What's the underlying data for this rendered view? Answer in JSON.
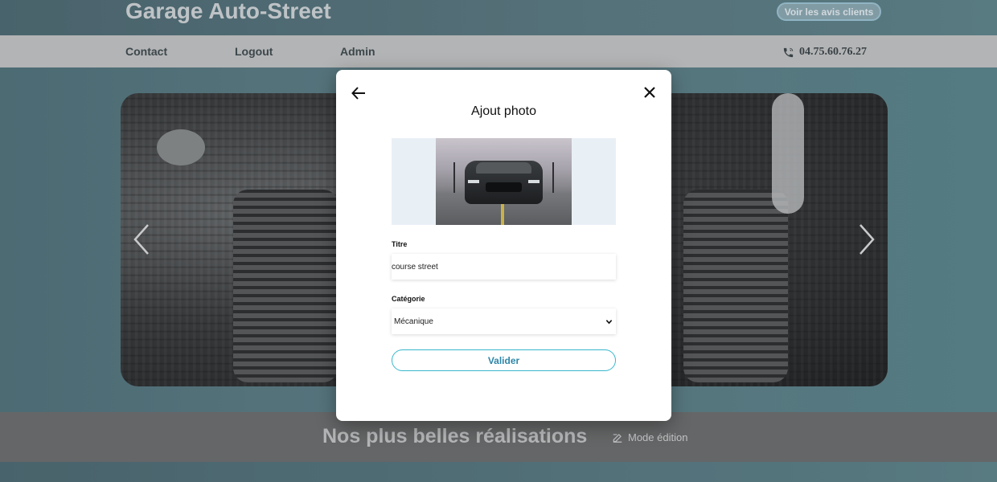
{
  "header": {
    "title": "Garage Auto-Street",
    "reviews_button": "Voir les avis clients"
  },
  "nav": {
    "items": [
      {
        "label": "Contact"
      },
      {
        "label": "Logout"
      },
      {
        "label": "Admin"
      }
    ],
    "phone": "04.75.60.76.27",
    "phone_icon": "phone-icon"
  },
  "carousel": {
    "prev_icon": "chevron-left-icon",
    "next_icon": "chevron-right-icon"
  },
  "section": {
    "title": "Nos plus belles réalisations",
    "edit_label": "Mode édition",
    "edit_icon": "edit-icon"
  },
  "modal": {
    "title": "Ajout photo",
    "back_icon": "arrow-left-icon",
    "close_icon": "close-icon",
    "title_field": {
      "label": "Titre",
      "value": "course street"
    },
    "category_field": {
      "label": "Catégorie",
      "selected": "Mécanique"
    },
    "submit_label": "Valider"
  },
  "colors": {
    "accent": "#37b7cc",
    "nav_bg": "#c6c6c6",
    "section_bg": "#6e6e6e"
  }
}
